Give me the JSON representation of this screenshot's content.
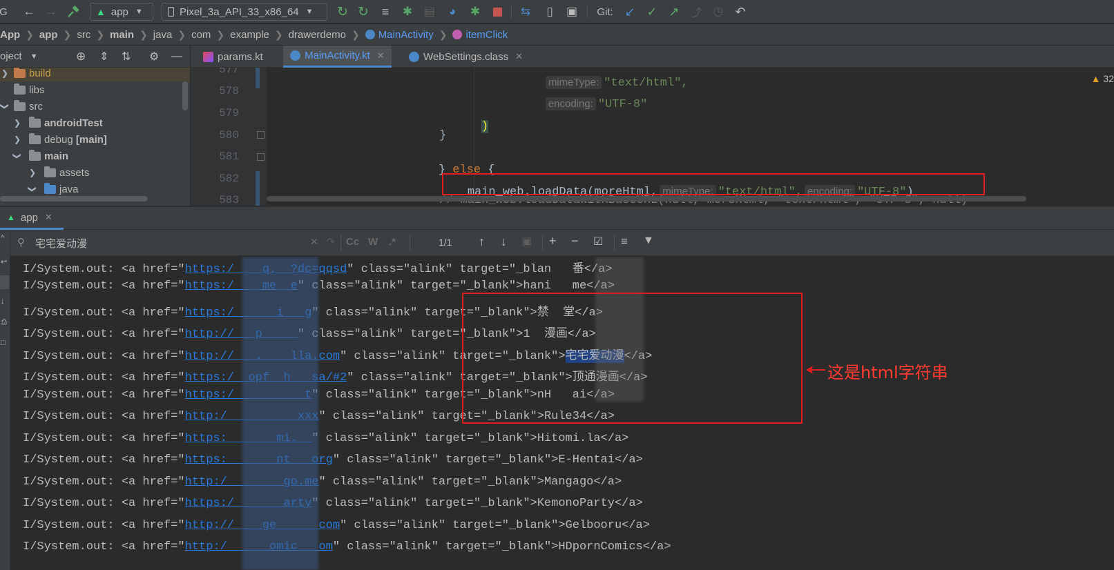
{
  "toolbar": {
    "run_config": "app",
    "device": "Pixel_3a_API_33_x86_64",
    "git_label": "Git:"
  },
  "breadcrumb": [
    "App",
    "app",
    "src",
    "main",
    "java",
    "com",
    "example",
    "drawerdemo",
    "MainActivity",
    "itemClick"
  ],
  "project": {
    "header": "oject",
    "tree": [
      {
        "label": "build",
        "open": false
      },
      {
        "label": "libs",
        "open": false
      },
      {
        "label": "src",
        "open": true
      },
      {
        "label": "androidTest",
        "open": false
      },
      {
        "label": "debug",
        "suffix": "[main]",
        "open": false
      },
      {
        "label": "main",
        "open": true
      },
      {
        "label": "assets",
        "open": false
      },
      {
        "label": "java",
        "open": true
      }
    ]
  },
  "editor": {
    "tabs": [
      {
        "label": "params.kt",
        "active": false
      },
      {
        "label": "MainActivity.kt",
        "active": true
      },
      {
        "label": "WebSettings.class",
        "active": false
      }
    ],
    "line_numbers": [
      "577",
      "578",
      "579",
      "580",
      "581",
      "582",
      "583"
    ],
    "lines": {
      "l577_hint": "mimeType:",
      "l577_str": "\"text/html\",",
      "l578_hint": "encoding:",
      "l578_str": "\"UTF-8\"",
      "l579": ")",
      "l580": "}",
      "l581_brace": "}",
      "l581_kw": "else",
      "l581_end": "{",
      "l582_code": "main_web.loadData(moreHtml,",
      "l582_hint1": "mimeType:",
      "l582_str1": "\"text/html\",",
      "l582_hint2": "encoding:",
      "l582_str2": "\"UTF-8\"",
      "l582_end": ")",
      "l583": "// main_web.loadDataWithBaseURL(null, moreHtml, \"text/html\", \"UTF-8\", null)"
    },
    "warning_count": "32"
  },
  "run": {
    "tab_label": "app",
    "search_query": "宅宅爱动漫",
    "match_count": "1/1",
    "log_prefix": "I/System.out: <a href=\"",
    "lines": [
      {
        "url": "https:/    q.  ?dc=qqsd",
        "rest": "\" class=\"alink\" target=\"_blan   番</a>"
      },
      {
        "url": "https:/    me  e",
        "rest": "\" class=\"alink\" target=\"_blank\">hani   me</a>"
      },
      {
        "url": "https:/      i   g",
        "rest": "\" class=\"alink\" target=\"_blank\">禁  堂</a>"
      },
      {
        "url": "http://   p     ",
        "rest": "\" class=\"alink\" target=\"_blank\">1  漫画</a>"
      },
      {
        "url": "http://   .    lla.com",
        "rest_before": "\" class=\"alink\" target=\"_blank\">",
        "highlight": "宅宅爱动漫",
        "rest_after": "</a>"
      },
      {
        "url": "https:/  opf  h   sa/#2",
        "rest": "\" class=\"alink\" target=\"_blank\">顶通漫画</a>"
      },
      {
        "url": "https:/          t",
        "rest": "\" class=\"alink\" target=\"_blank\">nH   ai</a>"
      },
      {
        "url": "http:/          xxx",
        "rest": "\" class=\"alink\" target=\"_blank\">Rule34</a>"
      },
      {
        "url": "https:       mi.  ",
        "rest": "\" class=\"alink\" target=\"_blank\">Hitomi.la</a>"
      },
      {
        "url": "https:       nt   org",
        "rest": "\" class=\"alink\" target=\"_blank\">E-Hentai</a>"
      },
      {
        "url": "http:/        go.me",
        "rest": "\" class=\"alink\" target=\"_blank\">Mangago</a>"
      },
      {
        "url": "https:/       arty",
        "rest": "\" class=\"alink\" target=\"_blank\">KemonoParty</a>"
      },
      {
        "url": "http://    ge      com",
        "rest": "\" class=\"alink\" target=\"_blank\">Gelbooru</a>"
      },
      {
        "url": "http:/      omic   om",
        "rest": "\" class=\"alink\" target=\"_blank\">HDpornComics</a>"
      }
    ]
  },
  "annotation": "这是html字符串",
  "colors": {
    "accent_blue": "#4a88c7",
    "annotation_red": "#e02020",
    "link_blue": "#287bde",
    "run_green": "#3c9b3c",
    "stop_red": "#c75450"
  }
}
